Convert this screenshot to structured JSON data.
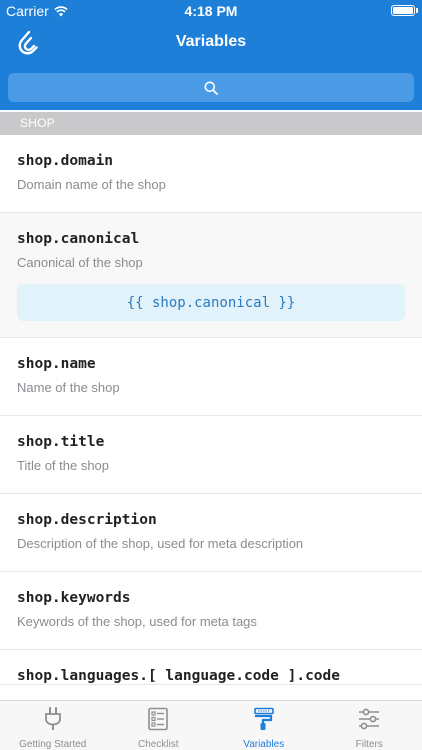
{
  "status_bar": {
    "carrier": "Carrier",
    "time": "4:18 PM"
  },
  "header": {
    "title": "Variables"
  },
  "search": {
    "icon": "search-icon"
  },
  "section": {
    "title": "SHOP"
  },
  "variables": [
    {
      "name": "shop.domain",
      "description": "Domain name of the shop"
    },
    {
      "name": "shop.canonical",
      "description": "Canonical of the shop",
      "code": "{{ shop.canonical }}"
    },
    {
      "name": "shop.name",
      "description": "Name of the shop"
    },
    {
      "name": "shop.title",
      "description": "Title of the shop"
    },
    {
      "name": "shop.description",
      "description": "Description of the shop, used for meta description"
    },
    {
      "name": "shop.keywords",
      "description": "Keywords of the shop, used for meta tags"
    },
    {
      "name": "shop.languages.[ language.code ].code",
      "description": ""
    }
  ],
  "tabs": [
    {
      "label": "Getting Started",
      "icon": "plug-icon",
      "active": false
    },
    {
      "label": "Checklist",
      "icon": "checklist-icon",
      "active": false
    },
    {
      "label": "Variables",
      "icon": "variables-icon",
      "active": true
    },
    {
      "label": "Filters",
      "icon": "sliders-icon",
      "active": false
    }
  ],
  "colors": {
    "header": "#1e7fd8",
    "accent": "#1e7fd8",
    "code_bg": "#e2f2fb",
    "section_bg": "#c9c9cc"
  }
}
